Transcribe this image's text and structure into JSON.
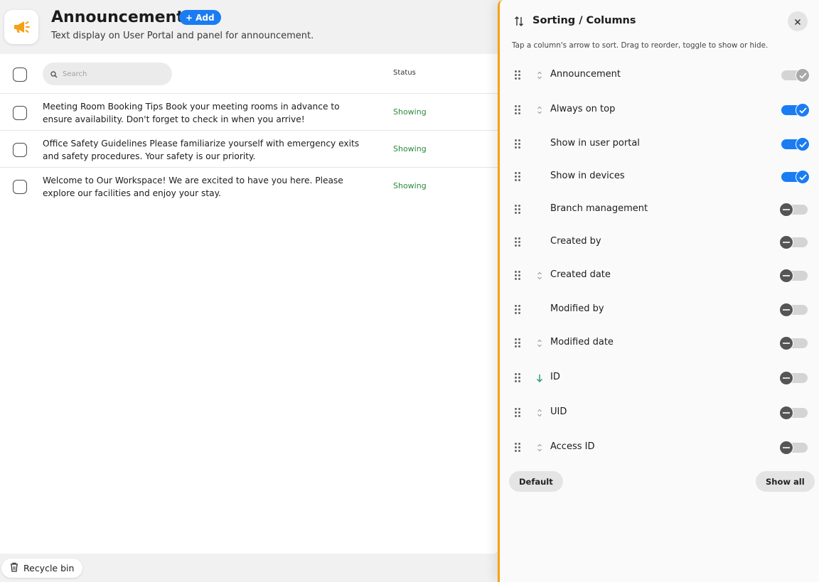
{
  "header": {
    "title": "Announcements",
    "add_label": "Add",
    "subtitle": "Text display on User Portal and panel for announcement."
  },
  "table": {
    "search_placeholder": "Search",
    "status_header": "Status",
    "rows": [
      {
        "text": "Meeting Room Booking Tips Book your meeting rooms in advance to ensure availability. Don't forget to check in when you arrive!",
        "status": "Showing"
      },
      {
        "text": "Office Safety Guidelines Please familiarize yourself with emergency exits and safety procedures. Your safety is our priority.",
        "status": "Showing"
      },
      {
        "text": "Welcome to Our Workspace! We are excited to have you here. Please explore our facilities and enjoy your stay.",
        "status": "Showing"
      }
    ]
  },
  "footer": {
    "recycle_label": "Recycle bin"
  },
  "panel": {
    "title": "Sorting / Columns",
    "hint": "Tap a column's arrow to sort. Drag to reorder, toggle to show or hide.",
    "columns": [
      {
        "label": "Announcement",
        "sort": "both",
        "state": "locked"
      },
      {
        "label": "Always on top",
        "sort": "both",
        "state": "on"
      },
      {
        "label": "Show in user portal",
        "sort": "none",
        "state": "on"
      },
      {
        "label": "Show in devices",
        "sort": "none",
        "state": "on"
      },
      {
        "label": "Branch management",
        "sort": "none",
        "state": "off"
      },
      {
        "label": "Created by",
        "sort": "none",
        "state": "off"
      },
      {
        "label": "Created date",
        "sort": "both",
        "state": "off"
      },
      {
        "label": "Modified by",
        "sort": "none",
        "state": "off"
      },
      {
        "label": "Modified date",
        "sort": "both",
        "state": "off"
      },
      {
        "label": "ID",
        "sort": "desc",
        "state": "off"
      },
      {
        "label": "UID",
        "sort": "both",
        "state": "off"
      },
      {
        "label": "Access ID",
        "sort": "both",
        "state": "off"
      }
    ],
    "default_label": "Default",
    "show_all_label": "Show all"
  },
  "colors": {
    "accent": "#1a7cf3",
    "panel_border": "#f5a016",
    "status_showing": "#2a8a3e",
    "sort_active": "#2a9d6a"
  }
}
